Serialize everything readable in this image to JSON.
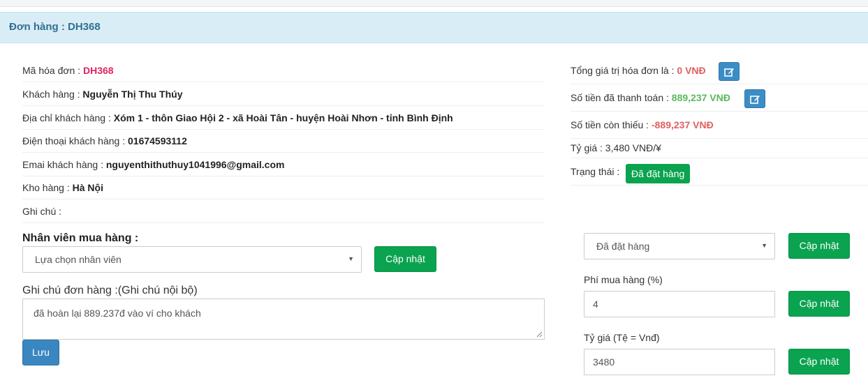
{
  "header": {
    "title": "Đơn hàng : DH368"
  },
  "info": {
    "invoice_label": "Mã hóa đơn : ",
    "invoice_value": "DH368",
    "customer_label": "Khách hàng : ",
    "customer_value": "Nguyễn Thị Thu Thúy",
    "address_label": "Địa chỉ khách hàng : ",
    "address_value": "Xóm 1 - thôn Giao Hội 2 - xã Hoài Tân - huyện Hoài Nhơn - tỉnh Bình Định",
    "phone_label": "Điện thoại khách hàng : ",
    "phone_value": "01674593112",
    "email_label": "Emai khách hàng : ",
    "email_value": "nguyenthithuthuy1041996@gmail.com",
    "warehouse_label": "Kho hàng : ",
    "warehouse_value": "Hà Nội",
    "note_label": "Ghi chú : "
  },
  "summary": {
    "total_label": "Tổng giá trị hóa đơn là : ",
    "total_value": "0 VNĐ",
    "paid_label": "Số tiền đã thanh toán : ",
    "paid_value": "889,237 VNĐ",
    "owed_label": "Số tiền còn thiếu : ",
    "owed_value": "-889,237 VNĐ",
    "rate_text": "Tỷ giá : 3,480 VNĐ/¥",
    "status_label": "Trạng thái : ",
    "status_value": "Đã đặt hàng"
  },
  "staff": {
    "label": "Nhân viên mua hàng :",
    "select_value": "Lựa chọn nhân viên",
    "update_label": "Cập nhật"
  },
  "internal_note": {
    "label": "Ghi chú đơn hàng :(Ghi chú nội bộ)",
    "value": "đã hoàn lại 889.237đ vào ví cho khách",
    "save_label": "Lưu"
  },
  "status_form": {
    "select_value": "Đã đặt hàng",
    "update_label": "Cập nhật"
  },
  "fee_form": {
    "label": "Phí mua hàng (%)",
    "value": "4",
    "update_label": "Cập nhật"
  },
  "rate_form": {
    "label": "Tỷ giá (Tệ = Vnđ)",
    "value": "3480",
    "update_label": "Cập nhật"
  },
  "colors": {
    "panel_bg": "#d9edf7",
    "panel_title": "#31708f",
    "accent_green": "#0aa34f",
    "accent_blue": "#3a86c0",
    "value_pink": "#e0245e",
    "value_red": "#e06060",
    "value_green": "#5cb85c"
  },
  "icons": {
    "edit": "edit-icon",
    "caret": "caret-down-icon",
    "resize": "resize-grip-icon"
  }
}
